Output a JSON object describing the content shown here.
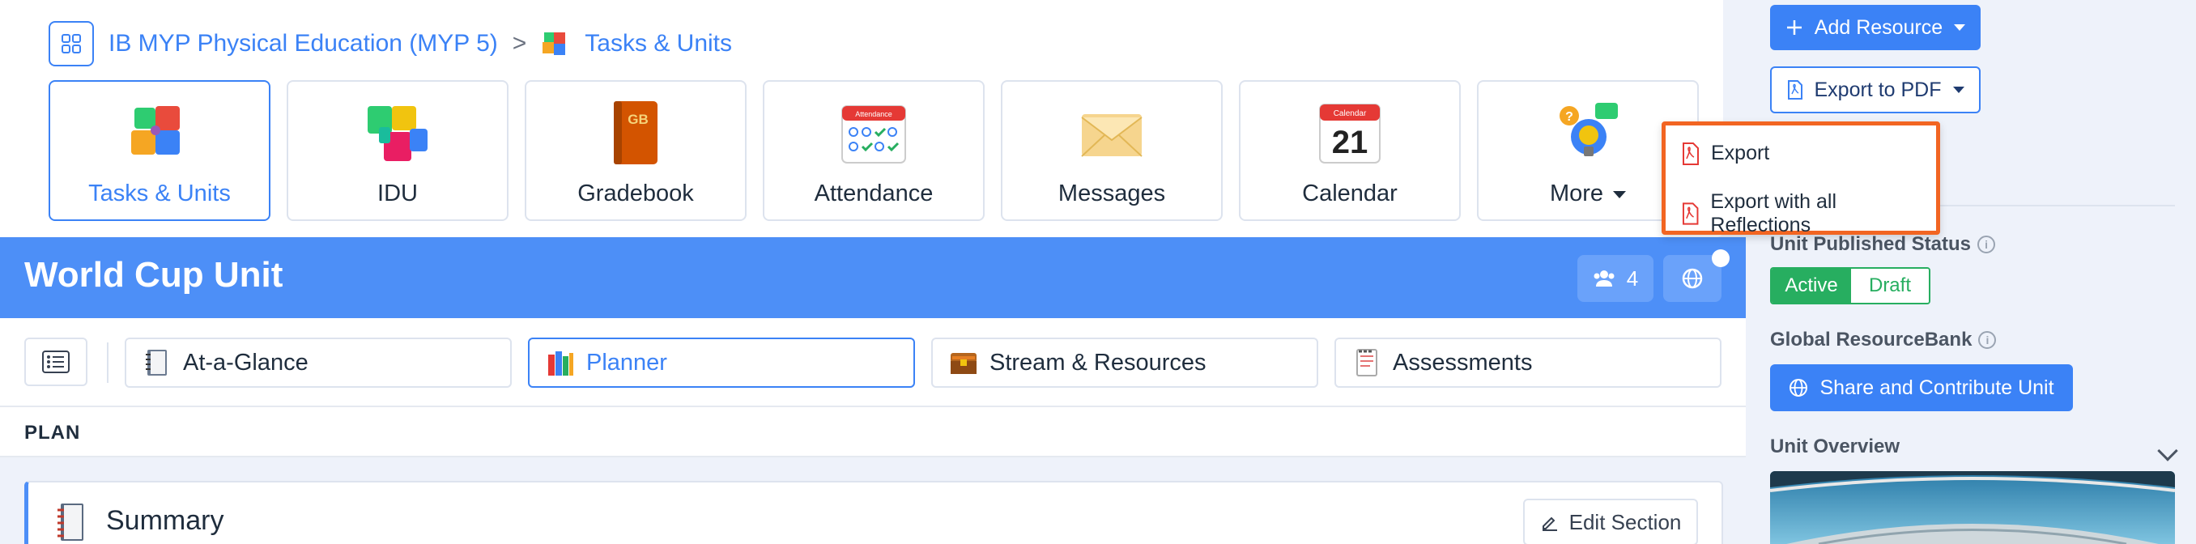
{
  "breadcrumb": {
    "course": "IB MYP Physical Education (MYP 5)",
    "separator": ">",
    "current": "Tasks & Units"
  },
  "tiles": [
    {
      "label": "Tasks & Units",
      "icon": "puzzle-icon",
      "active": true
    },
    {
      "label": "IDU",
      "icon": "puzzle-pieces-icon"
    },
    {
      "label": "Gradebook",
      "icon": "gradebook-icon",
      "badge": "GB"
    },
    {
      "label": "Attendance",
      "icon": "attendance-icon",
      "badge": "Attendance"
    },
    {
      "label": "Messages",
      "icon": "envelope-icon"
    },
    {
      "label": "Calendar",
      "icon": "calendar-icon",
      "badge": "Calendar",
      "day": "21"
    },
    {
      "label": "More",
      "icon": "help-bulb-icon",
      "has_caret": true
    }
  ],
  "banner": {
    "title": "World Cup Unit",
    "member_count": "4",
    "color": "#4d8ff7"
  },
  "tabs": [
    {
      "label": "At-a-Glance",
      "icon": "notebook-icon"
    },
    {
      "label": "Planner",
      "icon": "books-icon",
      "active": true
    },
    {
      "label": "Stream & Resources",
      "icon": "treasure-chest-icon"
    },
    {
      "label": "Assessments",
      "icon": "notepad-icon"
    }
  ],
  "plan": {
    "label": "PLAN"
  },
  "summary": {
    "title": "Summary",
    "edit_label": "Edit Section"
  },
  "right_panel": {
    "add_resource_label": "Add Resource",
    "export_pdf_label": "Export to PDF",
    "published_status_label": "Unit Published Status",
    "status_active": "Active",
    "status_draft": "Draft",
    "resource_bank_label": "Global ResourceBank",
    "share_label": "Share and Contribute Unit",
    "overview_label": "Unit Overview"
  },
  "export_menu": {
    "items": [
      "Export",
      "Export with all Reflections"
    ],
    "highlight_color": "#f26522"
  },
  "colors": {
    "accent": "#3b82f6",
    "success": "#27ae60",
    "pdf_red": "#e53935"
  }
}
